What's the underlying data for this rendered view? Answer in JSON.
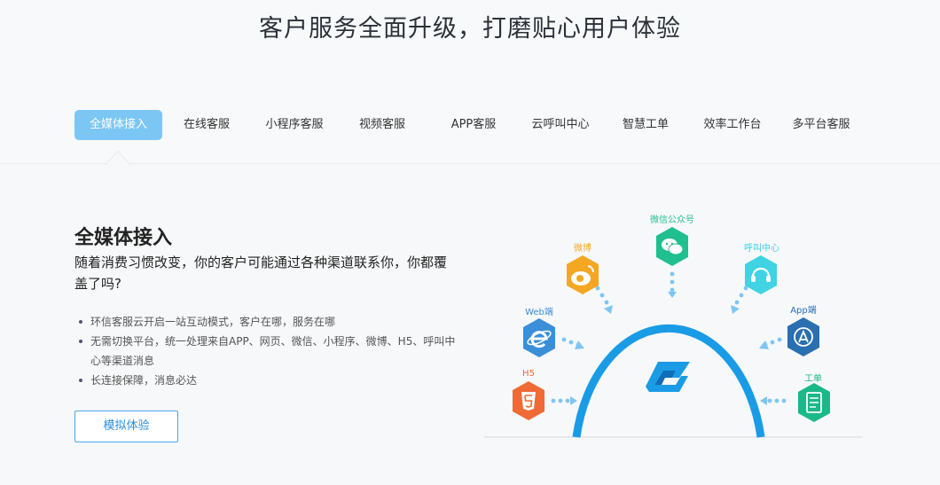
{
  "header": {
    "title": "客户服务全面升级，打磨贴心用户体验"
  },
  "tabs": [
    {
      "label": "全媒体接入",
      "active": true
    },
    {
      "label": "在线客服"
    },
    {
      "label": "小程序客服"
    },
    {
      "label": "视频客服"
    },
    {
      "label": "APP客服"
    },
    {
      "label": "云呼叫中心"
    },
    {
      "label": "智慧工单"
    },
    {
      "label": "效率工作台"
    },
    {
      "label": "多平台客服"
    }
  ],
  "content": {
    "title": "全媒体接入",
    "subtitle": "随着消费习惯改变，你的客户可能通过各种渠道联系你，你都覆盖了吗?",
    "bullets": [
      "环信客服云开启一站互动模式，客户在哪，服务在哪",
      "无需切换平台，统一处理来自APP、网页、微信、小程序、微博、H5、呼叫中心等渠道消息",
      "长连接保障，消息必达"
    ],
    "cta": "模拟体验"
  },
  "diagram": {
    "channels": [
      {
        "label": "微信公众号",
        "icon": "wechat-icon",
        "color": "#1fbf8f"
      },
      {
        "label": "微博",
        "icon": "weibo-icon",
        "color": "#f5a623"
      },
      {
        "label": "呼叫中心",
        "icon": "headset-icon",
        "color": "#3fd3e3"
      },
      {
        "label": "Web端",
        "icon": "ie-icon",
        "color": "#3a8fd8"
      },
      {
        "label": "App端",
        "icon": "appstore-icon",
        "color": "#2a6fb0"
      },
      {
        "label": "H5",
        "icon": "html5-icon",
        "color": "#f06a35"
      },
      {
        "label": "工单",
        "icon": "ticket-icon",
        "color": "#1bb889"
      }
    ],
    "center_icon": "kefu-logo-icon",
    "ring_color": "#1a9be6"
  }
}
